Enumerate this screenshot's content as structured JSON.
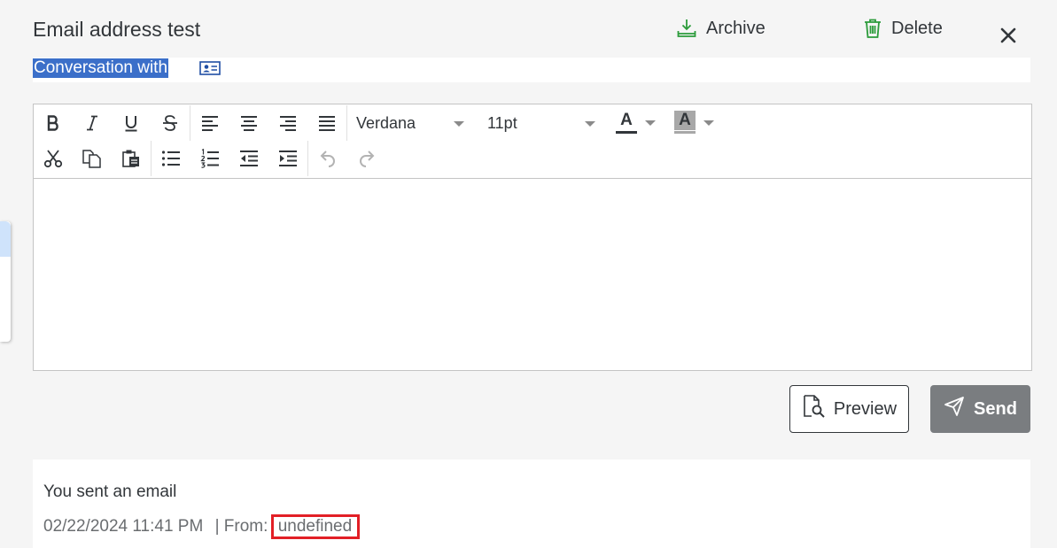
{
  "header": {
    "title": "Email address test",
    "archive_label": "Archive",
    "delete_label": "Delete"
  },
  "conversation": {
    "label": "Conversation with"
  },
  "toolbar": {
    "font_name": "Verdana",
    "font_size": "11pt",
    "text_color_glyph": "A",
    "highlight_glyph": "A"
  },
  "actions": {
    "preview_label": "Preview",
    "send_label": "Send"
  },
  "message": {
    "title": "You sent an email",
    "timestamp": "02/22/2024 11:41 PM",
    "from_label": "| From:",
    "from_value": "undefined"
  },
  "colors": {
    "accent_green": "#2b9b3a",
    "highlight_blue": "#3b6fc9",
    "send_button": "#7a7d80",
    "error_box": "#e21f26"
  }
}
